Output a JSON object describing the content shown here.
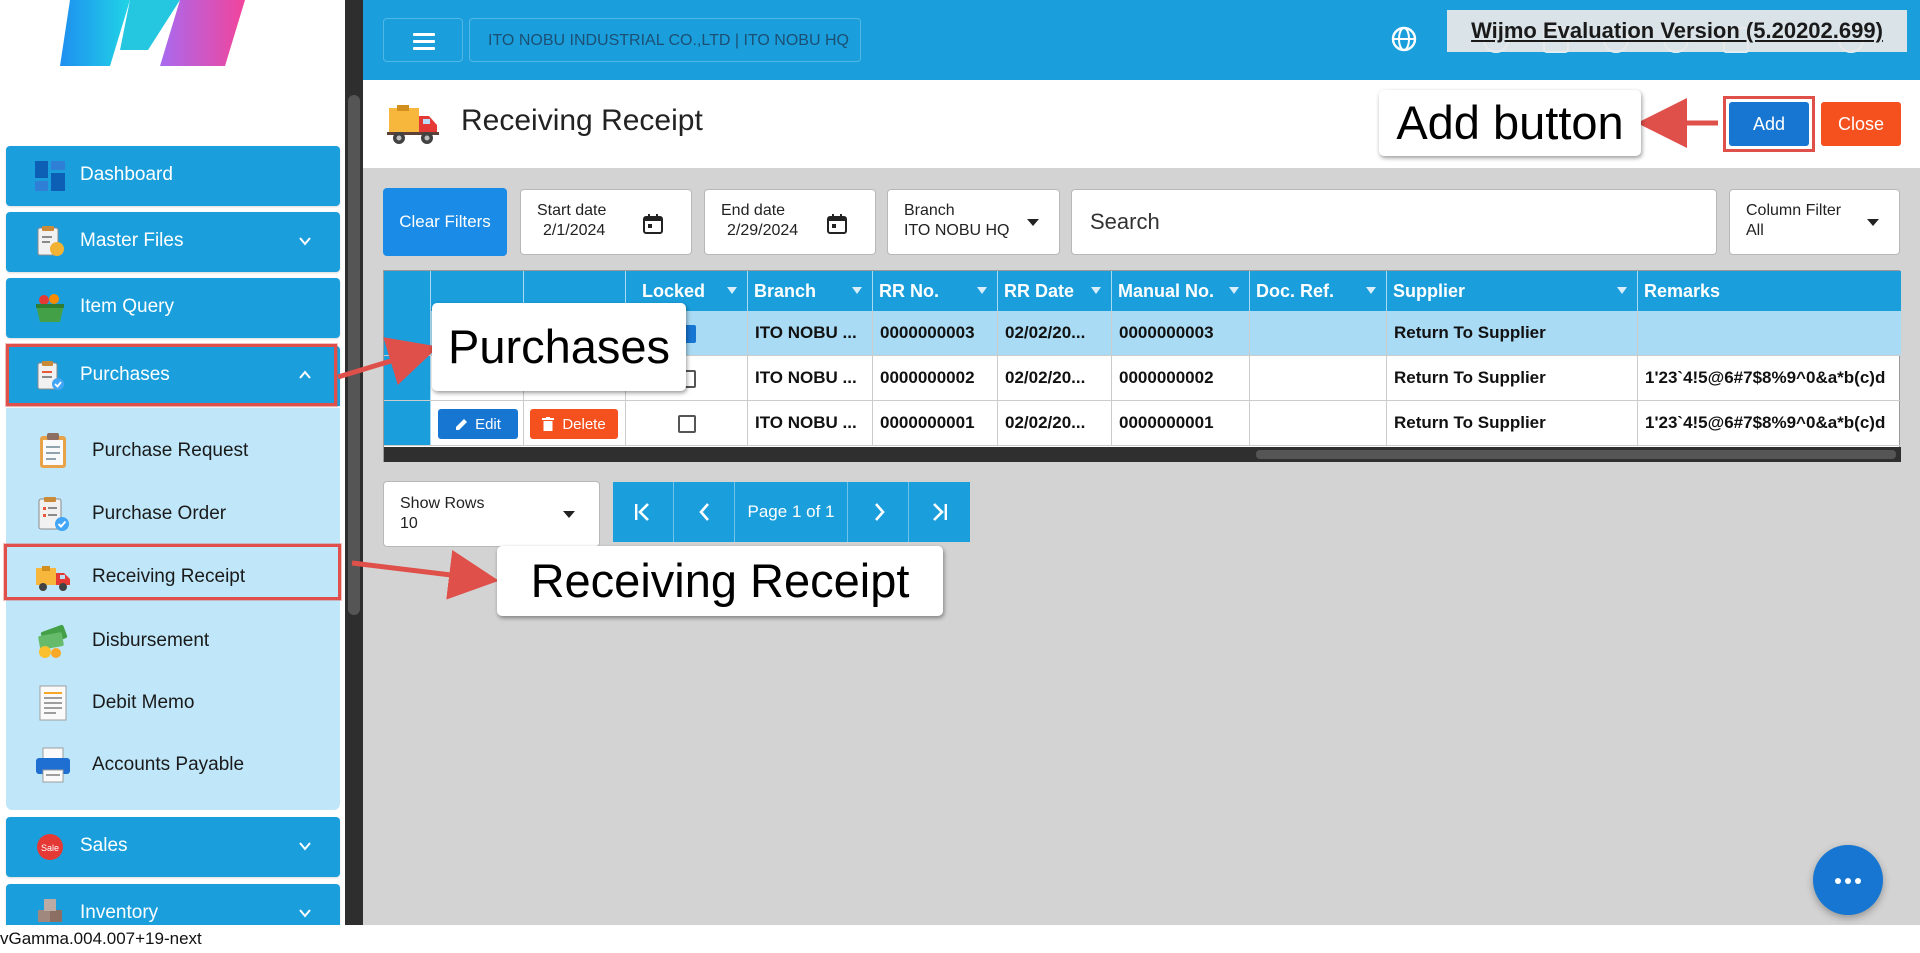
{
  "sidebar": {
    "items": [
      {
        "label": "Dashboard"
      },
      {
        "label": "Master Files"
      },
      {
        "label": "Item Query"
      },
      {
        "label": "Purchases"
      },
      {
        "label": "Sales"
      },
      {
        "label": "Inventory"
      }
    ],
    "purchases_submenu": [
      {
        "label": "Purchase Request"
      },
      {
        "label": "Purchase Order"
      },
      {
        "label": "Receiving Receipt"
      },
      {
        "label": "Disbursement"
      },
      {
        "label": "Debit Memo"
      },
      {
        "label": "Accounts Payable"
      }
    ]
  },
  "topbar": {
    "company": "ITO NOBU INDUSTRIAL CO.,LTD | ITO NOBU HQ",
    "watermark": "Wijmo Evaluation Version (5.20202.699)"
  },
  "page": {
    "title": "Receiving Receipt",
    "add_label": "Add",
    "close_label": "Close"
  },
  "filters": {
    "clear_label": "Clear Filters",
    "start_label": "Start date",
    "start_value": "2/1/2024",
    "end_label": "End date",
    "end_value": "2/29/2024",
    "branch_label": "Branch",
    "branch_value": "ITO NOBU HQ",
    "search_placeholder": "Search",
    "column_filter_label": "Column Filter",
    "column_filter_value": "All"
  },
  "grid": {
    "columns": [
      "Locked",
      "Branch",
      "RR No.",
      "RR Date",
      "Manual No.",
      "Doc. Ref.",
      "Supplier",
      "Remarks"
    ],
    "rows": [
      {
        "locked": true,
        "branch": "ITO NOBU ...",
        "rr_no": "0000000003",
        "rr_date": "02/02/20...",
        "manual_no": "0000000003",
        "doc_ref": "",
        "supplier": "Return To Supplier",
        "remarks": ""
      },
      {
        "locked": false,
        "branch": "ITO NOBU ...",
        "rr_no": "0000000002",
        "rr_date": "02/02/20...",
        "manual_no": "0000000002",
        "doc_ref": "",
        "supplier": "Return To Supplier",
        "remarks": "1'23`4!5@6#7$8%9^0&a*b(c)d"
      },
      {
        "locked": false,
        "branch": "ITO NOBU ...",
        "rr_no": "0000000001",
        "rr_date": "02/02/20...",
        "manual_no": "0000000001",
        "doc_ref": "",
        "supplier": "Return To Supplier",
        "remarks": "1'23`4!5@6#7$8%9^0&a*b(c)d"
      }
    ],
    "edit_label": "Edit",
    "delete_label": "Delete"
  },
  "pager": {
    "show_rows_label": "Show Rows",
    "show_rows_value": "10",
    "page_info": "Page 1 of 1"
  },
  "callouts": {
    "add": "Add button",
    "purchases": "Purchases",
    "receiving": "Receiving Receipt"
  },
  "footer": {
    "version": "vGamma.004.007+19-next"
  },
  "colors": {
    "primary": "#1a9fdc",
    "action_blue": "#1676d2",
    "danger": "#f4511e",
    "submenu_bg": "#bfe7f9",
    "highlight": "#e0504a"
  }
}
